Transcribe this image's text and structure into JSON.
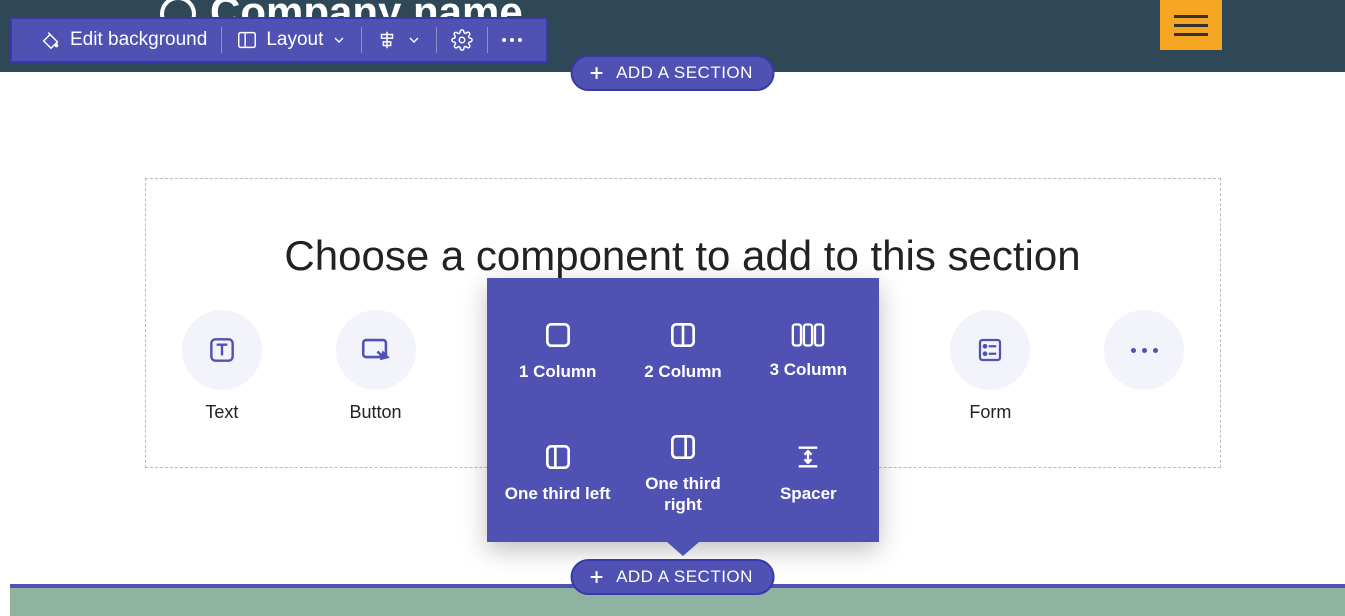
{
  "header": {
    "company_name": "Company name"
  },
  "toolbar": {
    "edit_bg": "Edit background",
    "layout": "Layout"
  },
  "add_section_label": "ADD A SECTION",
  "choose_heading": "Choose a component to add to this section",
  "components": {
    "text": "Text",
    "button": "Button",
    "form": "Form"
  },
  "layouts": {
    "c1": "1 Column",
    "c2": "2 Column",
    "c3": "3 Column",
    "third_left": "One third left",
    "third_right": "One third right",
    "spacer": "Spacer"
  }
}
